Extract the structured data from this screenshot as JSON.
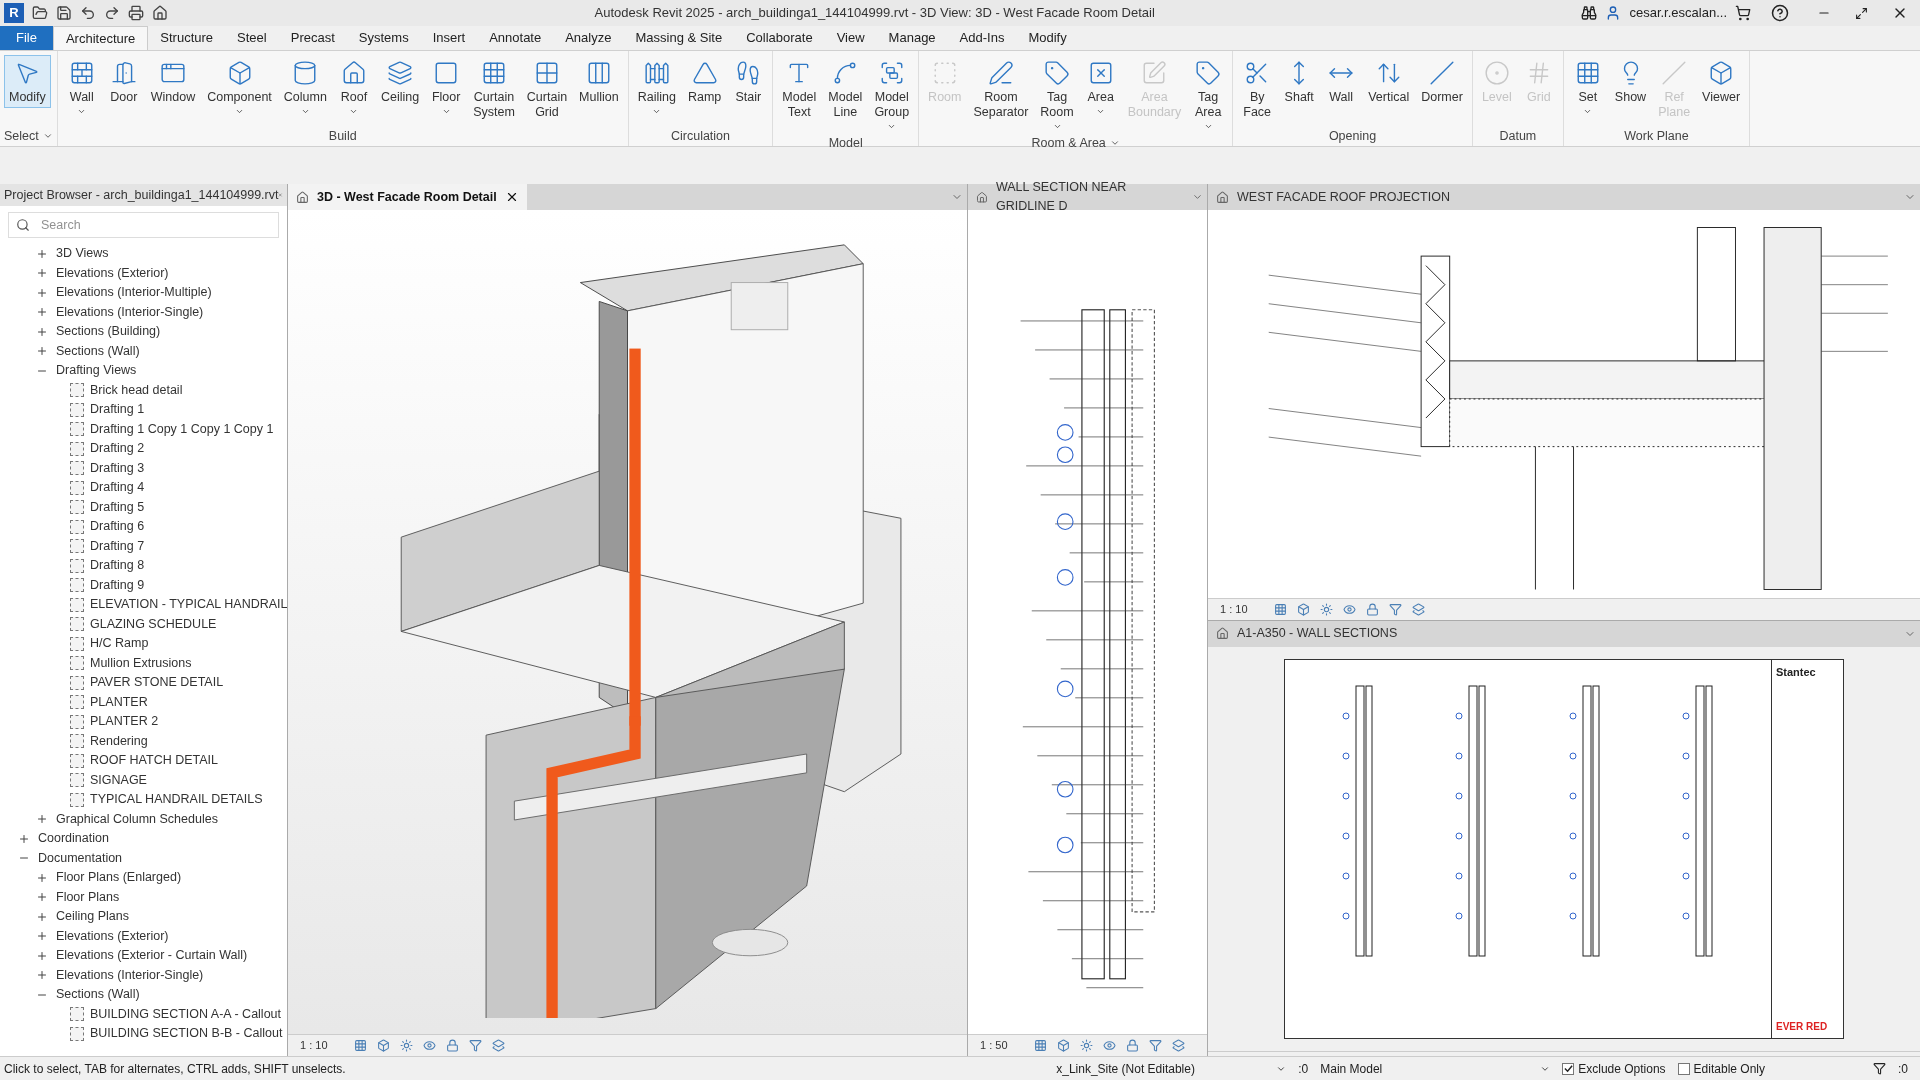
{
  "window": {
    "app_letter": "R",
    "title": "Autodesk Revit 2025 - arch_buildinga1_144104999.rvt - 3D View: 3D - West Facade Room Detail",
    "user": "cesar.r.escalan..."
  },
  "menu_tabs": [
    {
      "label": "File",
      "selected": false,
      "kind": "file"
    },
    {
      "label": "Architecture",
      "selected": true,
      "kind": "tab"
    },
    {
      "label": "Structure",
      "selected": false,
      "kind": "tab"
    },
    {
      "label": "Steel",
      "selected": false,
      "kind": "tab"
    },
    {
      "label": "Precast",
      "selected": false,
      "kind": "tab"
    },
    {
      "label": "Systems",
      "selected": false,
      "kind": "tab"
    },
    {
      "label": "Insert",
      "selected": false,
      "kind": "tab"
    },
    {
      "label": "Annotate",
      "selected": false,
      "kind": "tab"
    },
    {
      "label": "Analyze",
      "selected": false,
      "kind": "tab"
    },
    {
      "label": "Massing & Site",
      "selected": false,
      "kind": "tab"
    },
    {
      "label": "Collaborate",
      "selected": false,
      "kind": "tab"
    },
    {
      "label": "View",
      "selected": false,
      "kind": "tab"
    },
    {
      "label": "Manage",
      "selected": false,
      "kind": "tab"
    },
    {
      "label": "Add-Ins",
      "selected": false,
      "kind": "tab"
    },
    {
      "label": "Modify",
      "selected": false,
      "kind": "tab"
    }
  ],
  "ribbon": [
    {
      "label": "Select",
      "dropdown": true,
      "tools": [
        {
          "label": "Modify",
          "disabled": false,
          "dropdown": false,
          "selected": true
        }
      ]
    },
    {
      "label": "Build",
      "dropdown": false,
      "tools": [
        {
          "label": "Wall",
          "disabled": false,
          "dropdown": true,
          "selected": false
        },
        {
          "label": "Door",
          "disabled": false,
          "dropdown": false,
          "selected": false
        },
        {
          "label": "Window",
          "disabled": false,
          "dropdown": false,
          "selected": false
        },
        {
          "label": "Component",
          "disabled": false,
          "dropdown": true,
          "selected": false
        },
        {
          "label": "Column",
          "disabled": false,
          "dropdown": true,
          "selected": false
        },
        {
          "label": "Roof",
          "disabled": false,
          "dropdown": true,
          "selected": false
        },
        {
          "label": "Ceiling",
          "disabled": false,
          "dropdown": false,
          "selected": false
        },
        {
          "label": "Floor",
          "disabled": false,
          "dropdown": true,
          "selected": false
        },
        {
          "label": "Curtain System",
          "disabled": false,
          "dropdown": false,
          "selected": false
        },
        {
          "label": "Curtain Grid",
          "disabled": false,
          "dropdown": false,
          "selected": false
        },
        {
          "label": "Mullion",
          "disabled": false,
          "dropdown": false,
          "selected": false
        }
      ]
    },
    {
      "label": "Circulation",
      "dropdown": false,
      "tools": [
        {
          "label": "Railing",
          "disabled": false,
          "dropdown": true,
          "selected": false
        },
        {
          "label": "Ramp",
          "disabled": false,
          "dropdown": false,
          "selected": false
        },
        {
          "label": "Stair",
          "disabled": false,
          "dropdown": false,
          "selected": false
        }
      ]
    },
    {
      "label": "Model",
      "dropdown": false,
      "tools": [
        {
          "label": "Model Text",
          "disabled": false,
          "dropdown": false,
          "selected": false
        },
        {
          "label": "Model Line",
          "disabled": false,
          "dropdown": false,
          "selected": false
        },
        {
          "label": "Model Group",
          "disabled": false,
          "dropdown": true,
          "selected": false
        }
      ]
    },
    {
      "label": "Room & Area",
      "dropdown": true,
      "tools": [
        {
          "label": "Room",
          "disabled": true,
          "dropdown": false,
          "selected": false
        },
        {
          "label": "Room Separator",
          "disabled": false,
          "dropdown": false,
          "selected": false
        },
        {
          "label": "Tag Room",
          "disabled": false,
          "dropdown": true,
          "selected": false
        },
        {
          "label": "Area",
          "disabled": false,
          "dropdown": true,
          "selected": false
        },
        {
          "label": "Area Boundary",
          "disabled": true,
          "dropdown": false,
          "selected": false
        },
        {
          "label": "Tag Area",
          "disabled": false,
          "dropdown": true,
          "selected": false
        }
      ]
    },
    {
      "label": "Opening",
      "dropdown": false,
      "tools": [
        {
          "label": "By Face",
          "disabled": false,
          "dropdown": false,
          "selected": false
        },
        {
          "label": "Shaft",
          "disabled": false,
          "dropdown": false,
          "selected": false
        },
        {
          "label": "Wall",
          "disabled": false,
          "dropdown": false,
          "selected": false
        },
        {
          "label": "Vertical",
          "disabled": false,
          "dropdown": false,
          "selected": false
        },
        {
          "label": "Dormer",
          "disabled": false,
          "dropdown": false,
          "selected": false
        }
      ]
    },
    {
      "label": "Datum",
      "dropdown": false,
      "tools": [
        {
          "label": "Level",
          "disabled": true,
          "dropdown": false,
          "selected": false
        },
        {
          "label": "Grid",
          "disabled": true,
          "dropdown": false,
          "selected": false
        }
      ]
    },
    {
      "label": "Work Plane",
      "dropdown": false,
      "tools": [
        {
          "label": "Set",
          "disabled": false,
          "dropdown": true,
          "selected": false
        },
        {
          "label": "Show",
          "disabled": false,
          "dropdown": false,
          "selected": false
        },
        {
          "label": "Ref Plane",
          "disabled": true,
          "dropdown": false,
          "selected": false
        },
        {
          "label": "Viewer",
          "disabled": false,
          "dropdown": false,
          "selected": false
        }
      ]
    }
  ],
  "project_browser": {
    "title": "Project Browser - arch_buildinga1_144104999.rvt",
    "search": {
      "placeholder": "Search"
    },
    "tree": [
      {
        "children": [
          {
            "label": "3D Views",
            "expanded": false
          },
          {
            "label": "Elevations (Exterior)",
            "expanded": false
          },
          {
            "label": "Elevations (Interior-Multiple)",
            "expanded": false
          },
          {
            "label": "Elevations (Interior-Single)",
            "expanded": false
          },
          {
            "label": "Sections (Building)",
            "expanded": false
          },
          {
            "label": "Sections (Wall)",
            "expanded": false
          },
          {
            "label": "Drafting Views",
            "expanded": true,
            "children": [
              {
                "label": "Brick head detail"
              },
              {
                "label": "Drafting 1"
              },
              {
                "label": "Drafting 1 Copy 1 Copy 1 Copy 1"
              },
              {
                "label": "Drafting 2"
              },
              {
                "label": "Drafting 3"
              },
              {
                "label": "Drafting 4"
              },
              {
                "label": "Drafting 5"
              },
              {
                "label": "Drafting 6"
              },
              {
                "label": "Drafting 7"
              },
              {
                "label": "Drafting 8"
              },
              {
                "label": "Drafting 9"
              },
              {
                "label": "ELEVATION - TYPICAL HANDRAIL"
              },
              {
                "label": "GLAZING SCHEDULE"
              },
              {
                "label": "H/C Ramp"
              },
              {
                "label": "Mullion Extrusions"
              },
              {
                "label": "PAVER STONE DETAIL"
              },
              {
                "label": "PLANTER"
              },
              {
                "label": "PLANTER 2"
              },
              {
                "label": "Rendering"
              },
              {
                "label": "ROOF HATCH DETAIL"
              },
              {
                "label": "SIGNAGE"
              },
              {
                "label": "TYPICAL HANDRAIL DETAILS"
              }
            ]
          },
          {
            "label": "Graphical Column Schedules",
            "expanded": false
          }
        ]
      },
      {
        "label": "Coordination",
        "expanded": false
      },
      {
        "label": "Documentation",
        "expanded": true,
        "children": [
          {
            "label": "Floor Plans (Enlarged)",
            "expanded": false
          },
          {
            "label": "Floor Plans",
            "expanded": false
          },
          {
            "label": "Ceiling Plans",
            "expanded": false
          },
          {
            "label": "Elevations (Exterior)",
            "expanded": false
          },
          {
            "label": "Elevations (Exterior - Curtain Wall)",
            "expanded": false
          },
          {
            "label": "Elevations (Interior-Single)",
            "expanded": false
          },
          {
            "label": "Sections (Wall)",
            "expanded": true,
            "children": [
              {
                "label": "BUILDING SECTION A-A - Callout"
              },
              {
                "label": "BUILDING SECTION B-B - Callout"
              }
            ]
          }
        ]
      }
    ]
  },
  "views": [
    {
      "title": "3D - West Facade Room Detail",
      "active": true,
      "kind": "model3d",
      "scale": "1 : 10"
    },
    {
      "title": "WALL SECTION NEAR GRIDLINE D",
      "active": false,
      "kind": "section",
      "scale": "1 : 50"
    },
    {
      "title": "WEST FACADE ROOF PROJECTION",
      "active": false,
      "kind": "detail",
      "scale": "1 : 10"
    },
    {
      "title": "A1-A350 - WALL SECTIONS",
      "active": false,
      "kind": "sheet",
      "logo": "Stantec",
      "brand": "EVER RED"
    }
  ],
  "status_bar": {
    "message": "Click to select, TAB for alternates, CTRL adds, SHIFT unselects.",
    "link": "x_Link_Site (Not Editable)",
    "link_count": ":0",
    "model": "Main Model",
    "exclude_options": {
      "label": "Exclude Options",
      "checked": true
    },
    "editable_only": {
      "label": "Editable Only",
      "checked": false
    },
    "filter_count": ":0"
  }
}
